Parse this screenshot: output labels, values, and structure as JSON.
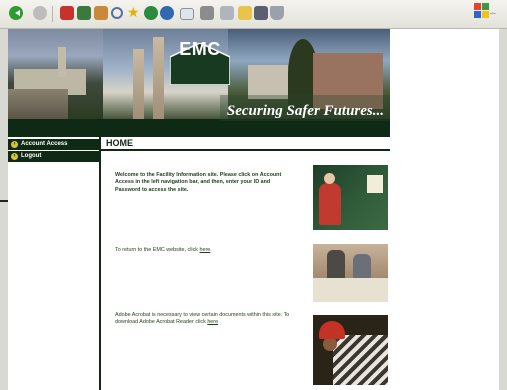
{
  "toolbar": {
    "buttons": [
      "back-icon",
      "forward-icon",
      "stop-icon",
      "refresh-icon",
      "home-icon",
      "search-icon",
      "favorites-icon",
      "history-icon",
      "media-icon",
      "mail-icon",
      "print-icon",
      "edit-icon",
      "folder-icon",
      "grid-icon",
      "messenger-icon"
    ]
  },
  "banner": {
    "logo_text": "EMC",
    "tagline": "Securing Safer Futures..."
  },
  "sidebar": {
    "items": [
      {
        "label": "Account Access"
      },
      {
        "label": "Logout"
      }
    ]
  },
  "main": {
    "title": "HOME",
    "welcome": "Welcome to the Facility Information site. Please click on Account Access in the left navigation bar, and then, enter your ID and Password to access the site.",
    "return_prefix": "To return to the EMC website, click ",
    "return_link": "here",
    "return_suffix": ".",
    "acrobat_prefix": "Adobe Acrobat is necessary to view certain documents within this site. To download Adobe Acrobat Reader click ",
    "acrobat_link": "here"
  },
  "colors": {
    "brand_dark_green": "#0f2a14",
    "text_green": "#1f3d1c",
    "bullet_gold": "#d9c23a"
  }
}
